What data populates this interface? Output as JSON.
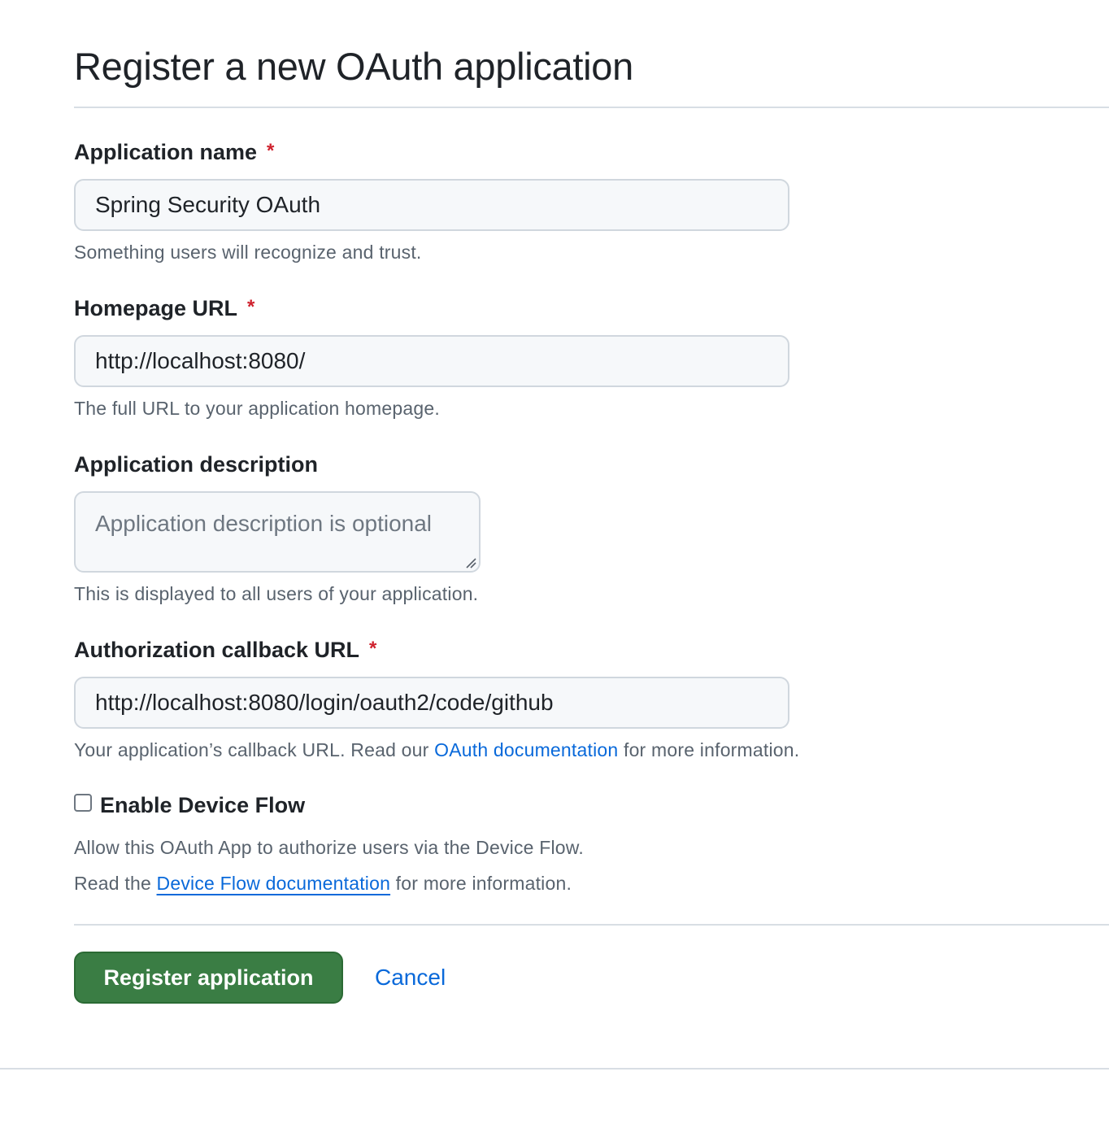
{
  "page_title": "Register a new OAuth application",
  "fields": {
    "app_name": {
      "label": "Application name",
      "required_marker": "*",
      "value": "Spring Security OAuth",
      "hint": "Something users will recognize and trust."
    },
    "homepage_url": {
      "label": "Homepage URL",
      "required_marker": "*",
      "value": "http://localhost:8080/",
      "hint": "The full URL to your application homepage."
    },
    "description": {
      "label": "Application description",
      "placeholder": "Application description is optional",
      "hint": "This is displayed to all users of your application."
    },
    "callback_url": {
      "label": "Authorization callback URL",
      "required_marker": "*",
      "value": "http://localhost:8080/login/oauth2/code/github",
      "hint_prefix": "Your application’s callback URL. Read our ",
      "hint_link": "OAuth documentation",
      "hint_suffix": " for more information."
    }
  },
  "device_flow": {
    "label": "Enable Device Flow",
    "checked": false,
    "description": "Allow this OAuth App to authorize users via the Device Flow.",
    "read_prefix": "Read the ",
    "read_link": "Device Flow documentation",
    "read_suffix": " for more information."
  },
  "actions": {
    "register_label": "Register application",
    "cancel_label": "Cancel"
  },
  "colors": {
    "primary_button": "#3a7d44",
    "link": "#0969da",
    "required": "#cf222e"
  }
}
